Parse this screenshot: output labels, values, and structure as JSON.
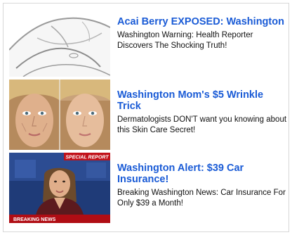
{
  "ads": [
    {
      "headline": "Acai Berry EXPOSED: Washington",
      "description": "Washington Warning: Health Reporter Discovers The Shocking Truth!",
      "image": "belly-sketch-illustration"
    },
    {
      "headline": "Washington Mom's $5 Wrinkle Trick",
      "description": "Dermatologists DON'T want you knowing about this Skin Care Secret!",
      "image": "before-after-faces-photo"
    },
    {
      "headline": "Washington Alert: $39 Car Insurance!",
      "description": "Breaking Washington News: Car Insurance For Only $39 a Month!",
      "image": "news-anchor-photo",
      "image_banner_top": "SPECIAL REPORT",
      "image_banner_bottom": "BREAKING NEWS"
    }
  ],
  "colors": {
    "headline": "#1a5bd6",
    "body_text": "#111111",
    "border": "#d8d8d8"
  }
}
